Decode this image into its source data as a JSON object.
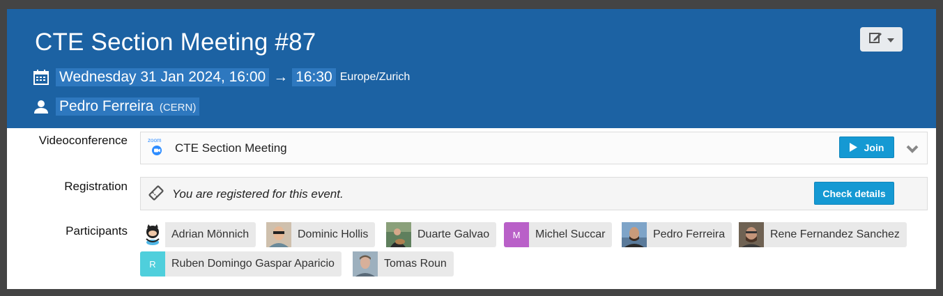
{
  "event": {
    "title": "CTE Section Meeting #87",
    "date_start": "Wednesday 31 Jan 2024, 16:00",
    "arrow": "→",
    "time_end": "16:30",
    "timezone": "Europe/Zurich",
    "chair_name": "Pedro Ferreira",
    "chair_affiliation": "(CERN)"
  },
  "videoconference": {
    "label": "Videoconference",
    "provider_logo_text": "zoom",
    "room_name": "CTE Section Meeting",
    "join_label": "Join"
  },
  "registration": {
    "label": "Registration",
    "message": "You are registered for this event.",
    "button_label": "Check details"
  },
  "participants": {
    "label": "Participants",
    "items": [
      {
        "name": "Adrian Mönnich",
        "initial": "",
        "color": "#ffffff"
      },
      {
        "name": "Dominic Hollis",
        "initial": "",
        "color": "#c9a98c"
      },
      {
        "name": "Duarte Galvao",
        "initial": "",
        "color": "#5a7a5a"
      },
      {
        "name": "Michel Succar",
        "initial": "M",
        "color": "#b960c8"
      },
      {
        "name": "Pedro Ferreira",
        "initial": "",
        "color": "#6a8fb5"
      },
      {
        "name": "Rene Fernandez Sanchez",
        "initial": "",
        "color": "#7a6a58"
      },
      {
        "name": "Ruben Domingo Gaspar Aparicio",
        "initial": "R",
        "color": "#4fcfdc"
      },
      {
        "name": "Tomas Roun",
        "initial": "",
        "color": "#8aa0b0"
      }
    ]
  }
}
